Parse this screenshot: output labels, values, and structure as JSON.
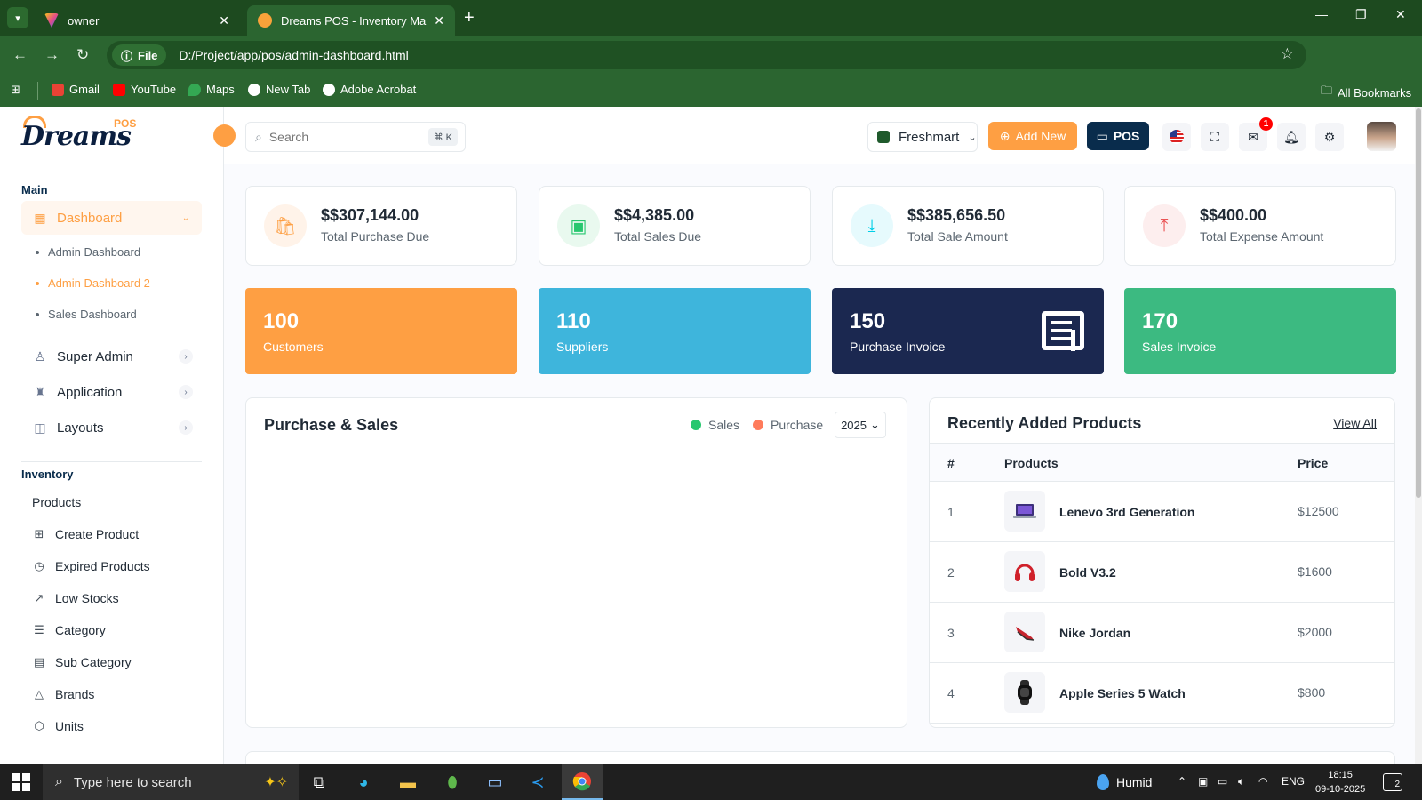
{
  "browser": {
    "tabs": [
      {
        "title": "owner",
        "active": false
      },
      {
        "title": "Dreams POS - Inventory Manag",
        "active": true
      }
    ],
    "address": {
      "scheme_label": "File",
      "url": "D:/Project/app/pos/admin-dashboard.html"
    },
    "bookmarks": [
      "Gmail",
      "YouTube",
      "Maps",
      "New Tab",
      "Adobe Acrobat"
    ],
    "all_bookmarks": "All Bookmarks"
  },
  "app": {
    "logo_text": "Dreams",
    "logo_sub": "POS",
    "header": {
      "search_placeholder": "Search",
      "search_shortcut": "⌘ K",
      "store": "Freshmart",
      "add_new": "Add New",
      "pos": "POS",
      "mail_badge": "1"
    },
    "sidebar": {
      "main_label": "Main",
      "dashboard": "Dashboard",
      "dashboard_sub": [
        "Admin Dashboard",
        "Admin Dashboard 2",
        "Sales Dashboard"
      ],
      "super_admin": "Super Admin",
      "application": "Application",
      "layouts": "Layouts",
      "inventory_label": "Inventory",
      "inventory_items": [
        "Products",
        "Create Product",
        "Expired Products",
        "Low Stocks",
        "Category",
        "Sub Category",
        "Brands",
        "Units"
      ]
    },
    "stats": [
      {
        "value": "$$307,144.00",
        "label": "Total Purchase Due",
        "color": "#fe9f43"
      },
      {
        "value": "$$4,385.00",
        "label": "Total Sales Due",
        "color": "#28c76f"
      },
      {
        "value": "$$385,656.50",
        "label": "Total Sale Amount",
        "color": "#00cfe8"
      },
      {
        "value": "$$400.00",
        "label": "Total Expense Amount",
        "color": "#ea5455"
      }
    ],
    "counts": [
      {
        "number": "100",
        "label": "Customers",
        "color": "#fe9f43"
      },
      {
        "number": "110",
        "label": "Suppliers",
        "color": "#3eb5dc"
      },
      {
        "number": "150",
        "label": "Purchase Invoice",
        "color": "#1b2850"
      },
      {
        "number": "170",
        "label": "Sales Invoice",
        "color": "#3cba81"
      }
    ],
    "purchase_sales": {
      "title": "Purchase & Sales",
      "legend": [
        {
          "label": "Sales",
          "color": "#28c76f"
        },
        {
          "label": "Purchase",
          "color": "#ff7b5b"
        }
      ],
      "year": "2025"
    },
    "recent_products": {
      "title": "Recently Added Products",
      "view_all": "View All",
      "columns": [
        "#",
        "Products",
        "Price"
      ],
      "rows": [
        {
          "index": "1",
          "name": "Lenevo 3rd Generation",
          "price": "$12500"
        },
        {
          "index": "2",
          "name": "Bold V3.2",
          "price": "$1600"
        },
        {
          "index": "3",
          "name": "Nike Jordan",
          "price": "$2000"
        },
        {
          "index": "4",
          "name": "Apple Series 5 Watch",
          "price": "$800"
        }
      ]
    }
  },
  "taskbar": {
    "search_placeholder": "Type here to search",
    "weather": "Humid",
    "language": "ENG",
    "time": "18:15",
    "date": "09-10-2025",
    "notifications": "2"
  }
}
